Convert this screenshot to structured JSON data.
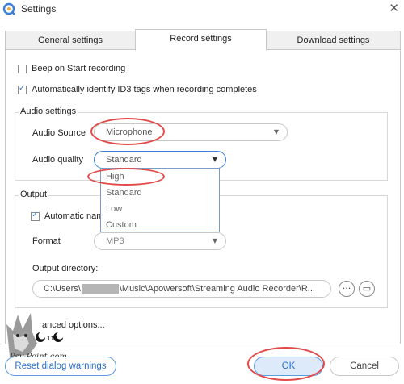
{
  "window": {
    "title": "Settings",
    "close_glyph": "✕"
  },
  "tabs": [
    {
      "label": "General settings",
      "active": false
    },
    {
      "label": "Record settings",
      "active": true
    },
    {
      "label": "Download settings",
      "active": false
    }
  ],
  "record": {
    "beep_label": "Beep on Start recording",
    "beep_checked": false,
    "id3_label": "Automatically identify ID3 tags when recording completes",
    "id3_checked": true
  },
  "audio_settings": {
    "title": "Audio settings",
    "source_label": "Audio Source",
    "source_value": "Microphone",
    "quality_label": "Audio quality",
    "quality_value": "Standard",
    "quality_options": [
      "High",
      "Standard",
      "Low",
      "Custom"
    ],
    "hovered_option": "High"
  },
  "output": {
    "title": "Output",
    "auto_naming_label": "Automatic nami",
    "auto_naming_checked": true,
    "format_label": "Format",
    "format_value": "MP3",
    "directory_label": "Output directory:",
    "path_prefix": "C:\\Users\\",
    "path_suffix": "\\Music\\Apowersoft\\Streaming Audio Recorder\\R...",
    "more_glyph": "···",
    "folder_glyph": "▭"
  },
  "advanced_label": "anced options...",
  "watermark": {
    "text": "Psy-Point.com",
    "number": "114"
  },
  "footer": {
    "reset_label": "Reset dialog warnings",
    "ok_label": "OK",
    "cancel_label": "Cancel"
  },
  "colors": {
    "accent": "#3b7fd6",
    "annotation": "#e24a4a"
  },
  "icons": {
    "caret": "▼",
    "check": "✓"
  }
}
